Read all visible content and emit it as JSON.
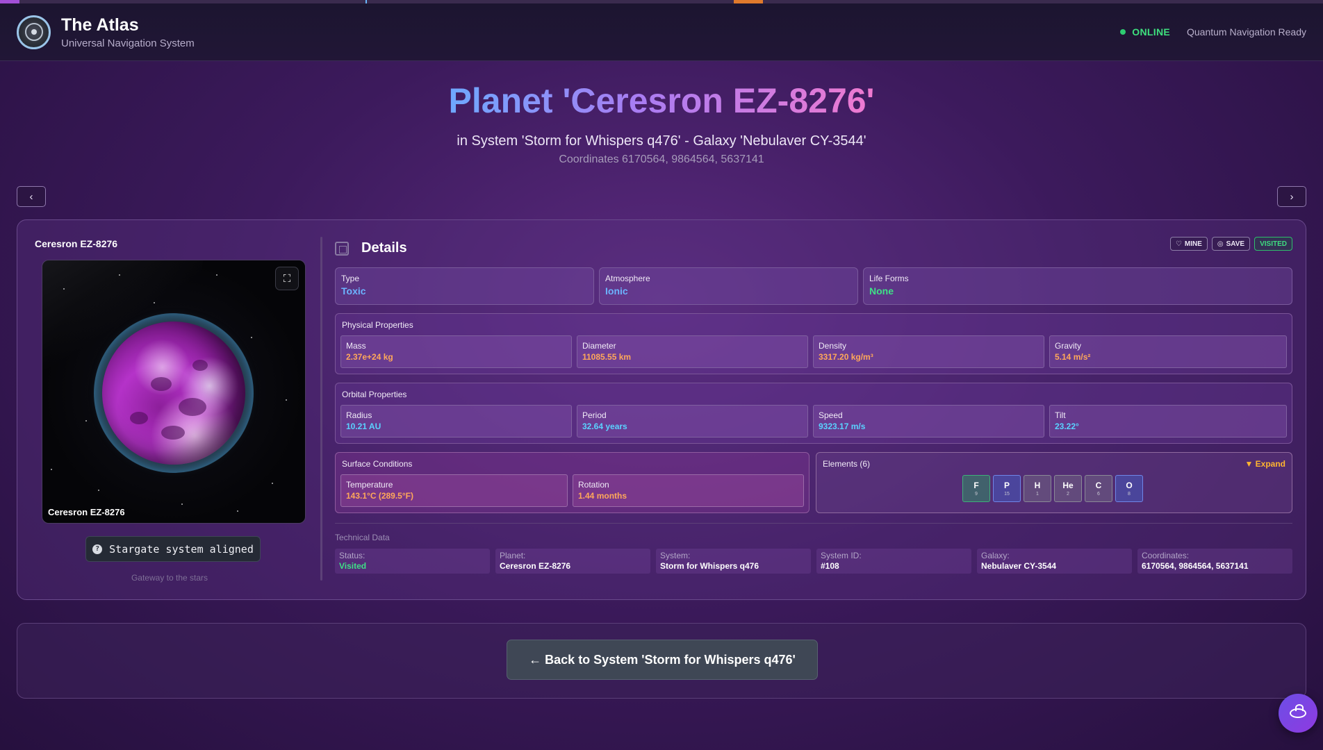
{
  "header": {
    "title": "The Atlas",
    "subtitle": "Universal Navigation System",
    "status": "ONLINE",
    "status_text": "Quantum Navigation Ready"
  },
  "hero": {
    "title": "Planet 'Ceresron EZ-8276'",
    "subtitle": "in System 'Storm for Whispers q476' - Galaxy 'Nebulaver CY-3544'",
    "coordinates": "Coordinates 6170564, 9864564, 5637141"
  },
  "nav": {
    "prev": "‹",
    "next": "›"
  },
  "planet_panel": {
    "name": "Ceresron EZ-8276",
    "caption": "Ceresron EZ-8276",
    "expand_glyph": "⛶",
    "stargate_icon": "?",
    "stargate_label": "Stargate system aligned",
    "gateway_text": "Gateway to the stars"
  },
  "details": {
    "title": "Details",
    "actions": {
      "mine": "MINE",
      "save": "SAVE",
      "visited": "VISITED"
    },
    "type": {
      "label": "Type",
      "value": "Toxic"
    },
    "atmosphere": {
      "label": "Atmosphere",
      "value": "Ionic"
    },
    "life_forms": {
      "label": "Life Forms",
      "value": "None"
    },
    "physical": {
      "title": "Physical Properties",
      "items": [
        {
          "label": "Mass",
          "value": "2.37e+24 kg"
        },
        {
          "label": "Diameter",
          "value": "11085.55 km"
        },
        {
          "label": "Density",
          "value": "3317.20 kg/m³"
        },
        {
          "label": "Gravity",
          "value": "5.14 m/s²"
        }
      ]
    },
    "orbital": {
      "title": "Orbital Properties",
      "items": [
        {
          "label": "Radius",
          "value": "10.21 AU"
        },
        {
          "label": "Period",
          "value": "32.64 years"
        },
        {
          "label": "Speed",
          "value": "9323.17 m/s"
        },
        {
          "label": "Tilt",
          "value": "23.22°"
        }
      ]
    },
    "surface": {
      "title": "Surface Conditions",
      "items": [
        {
          "label": "Temperature",
          "value": "143.1°C (289.5°F)"
        },
        {
          "label": "Rotation",
          "value": "1.44 months"
        }
      ]
    },
    "elements": {
      "title": "Elements (6)",
      "expand": "▼ Expand",
      "items": [
        {
          "symbol": "F",
          "number": "9",
          "color": "green"
        },
        {
          "symbol": "P",
          "number": "15",
          "color": "blue"
        },
        {
          "symbol": "H",
          "number": "1",
          "color": "gray"
        },
        {
          "symbol": "He",
          "number": "2",
          "color": "gray"
        },
        {
          "symbol": "C",
          "number": "6",
          "color": "gray"
        },
        {
          "symbol": "O",
          "number": "8",
          "color": "blue"
        }
      ]
    },
    "technical": {
      "title": "Technical Data",
      "items": [
        {
          "label": "Status:",
          "value": "Visited"
        },
        {
          "label": "Planet:",
          "value": "Ceresron EZ-8276"
        },
        {
          "label": "System:",
          "value": "Storm for Whispers q476"
        },
        {
          "label": "System ID:",
          "value": "#108"
        },
        {
          "label": "Galaxy:",
          "value": "Nebulaver CY-3544"
        },
        {
          "label": "Coordinates:",
          "value": "6170564, 9864564, 5637141"
        }
      ]
    }
  },
  "back_button": "← Back to System 'Storm for Whispers q476'",
  "colors": {
    "accent_orange": "#ffa85a",
    "accent_cyan": "#5ad2ff",
    "accent_green": "#3fe087",
    "status_online": "#2ecc71"
  }
}
